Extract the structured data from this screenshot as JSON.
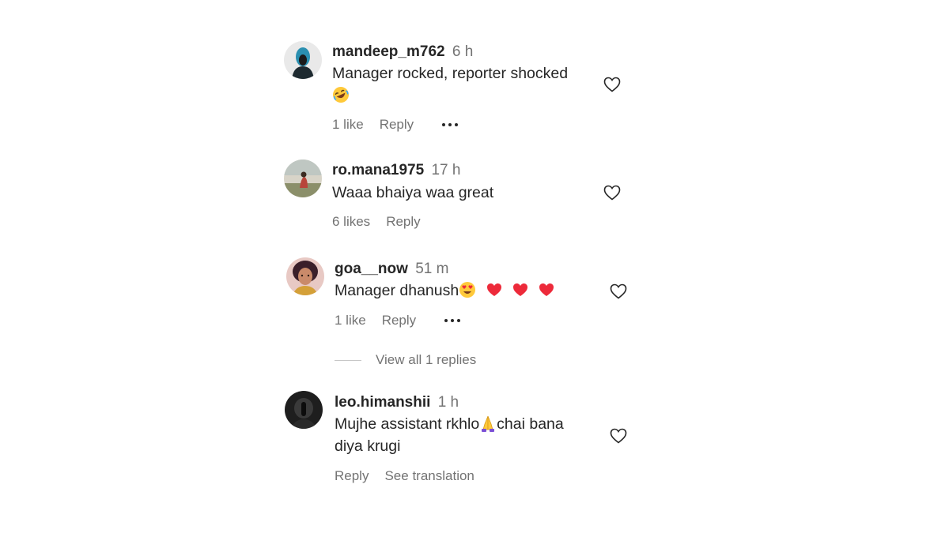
{
  "comments": [
    {
      "username": "mandeep_m762",
      "time": "6 h",
      "text_line1": "Manager rocked, reporter shocked",
      "emoji": "rofl-emoji",
      "likes": "1 like",
      "reply": "Reply"
    },
    {
      "username": "ro.mana1975",
      "time": "17 h",
      "text": "Waaa bhaiya waa great",
      "likes": "6 likes",
      "reply": "Reply"
    },
    {
      "username": "goa__now",
      "time": "51 m",
      "text": "Manager dhanush",
      "emojis": [
        "heart-eyes-emoji",
        "red-heart-emoji",
        "red-heart-emoji",
        "red-heart-emoji"
      ],
      "likes": "1 like",
      "reply": "Reply",
      "view_replies": "View all 1 replies"
    },
    {
      "username": "leo.himanshii",
      "time": "1 h",
      "text_part1": "Mujhe assistant rkhlo",
      "emoji": "folded-hands-emoji",
      "text_part2": "chai bana",
      "text_line2": "diya krugi",
      "reply": "Reply",
      "see_translation": "See translation"
    }
  ],
  "icons": {
    "like": "heart-outline-icon",
    "more": "more-options-icon"
  },
  "colors": {
    "text": "#262626",
    "secondary": "#737373",
    "heart_red": "#ed2a3a",
    "emoji_yellow": "#ffc93a"
  }
}
